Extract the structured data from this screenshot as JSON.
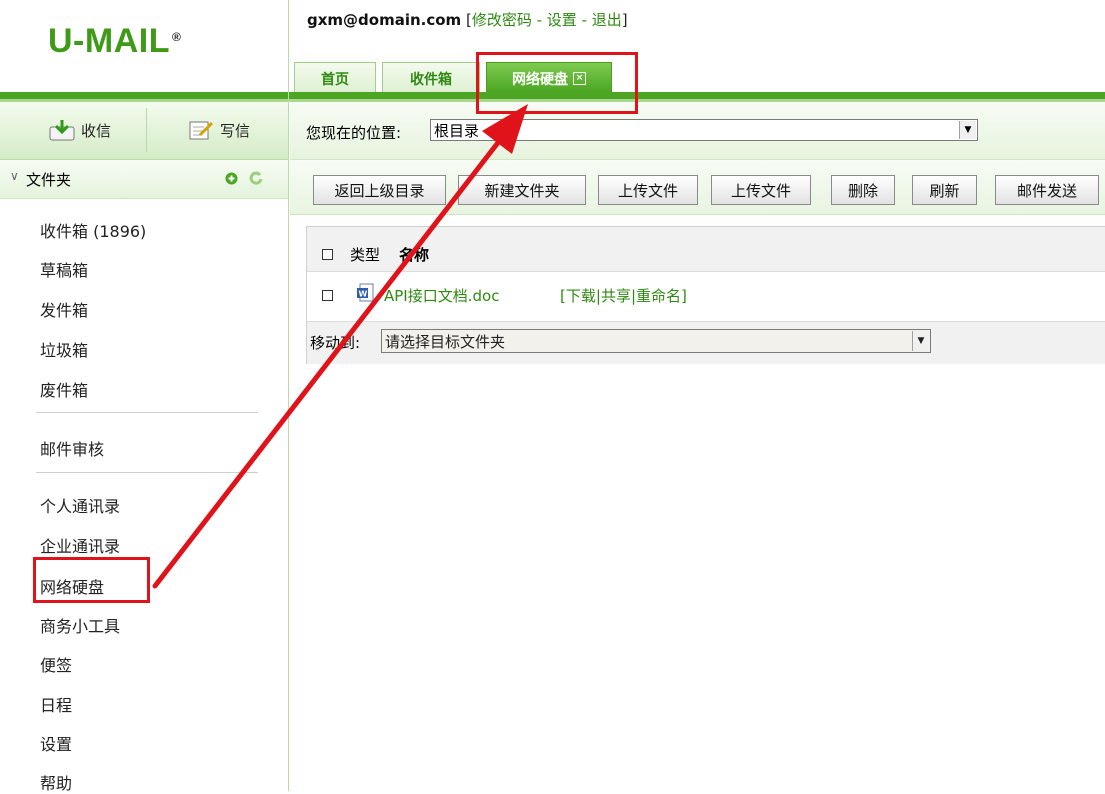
{
  "header": {
    "logo": "U-MAIL",
    "logo_mark": "®",
    "email": "gxm@domain.com",
    "bracket_open": "[",
    "change_password": "修改密码",
    "sep1": " - ",
    "settings": "设置",
    "sep2": " - ",
    "logout": "退出",
    "bracket_close": "]"
  },
  "tabs": [
    {
      "label": "首页"
    },
    {
      "label": "收件箱"
    },
    {
      "label": "网络硬盘",
      "close": "×"
    }
  ],
  "sidebar": {
    "receive": "收信",
    "write": "写信",
    "folder_title": "文件夹",
    "folders": [
      "收件箱 (1896)",
      "草稿箱",
      "发件箱",
      "垃圾箱",
      "废件箱"
    ],
    "audit": "邮件审核",
    "tools": [
      "个人通讯录",
      "企业通讯录",
      "网络硬盘",
      "商务小工具",
      "便签",
      "日程",
      "设置",
      "帮助"
    ]
  },
  "main": {
    "location_label": "您现在的位置:",
    "location_value": "根目录",
    "toolbar": [
      "返回上级目录",
      "新建文件夹",
      "上传文件",
      "上传文件",
      "删除",
      "刷新",
      "邮件发送"
    ],
    "col_type": "类型",
    "col_name": "名称",
    "file": {
      "name": "API接口文档.doc",
      "open": "[",
      "download": "下载",
      "share": "共享",
      "rename": "重命名",
      "close": "]",
      "pipe": "|"
    },
    "move_label": "移动到:",
    "move_placeholder": "请选择目标文件夹"
  },
  "colors": {
    "brand_green": "#3f9a17",
    "link_green": "#2f8a12",
    "annotation_red": "#e0131a"
  }
}
